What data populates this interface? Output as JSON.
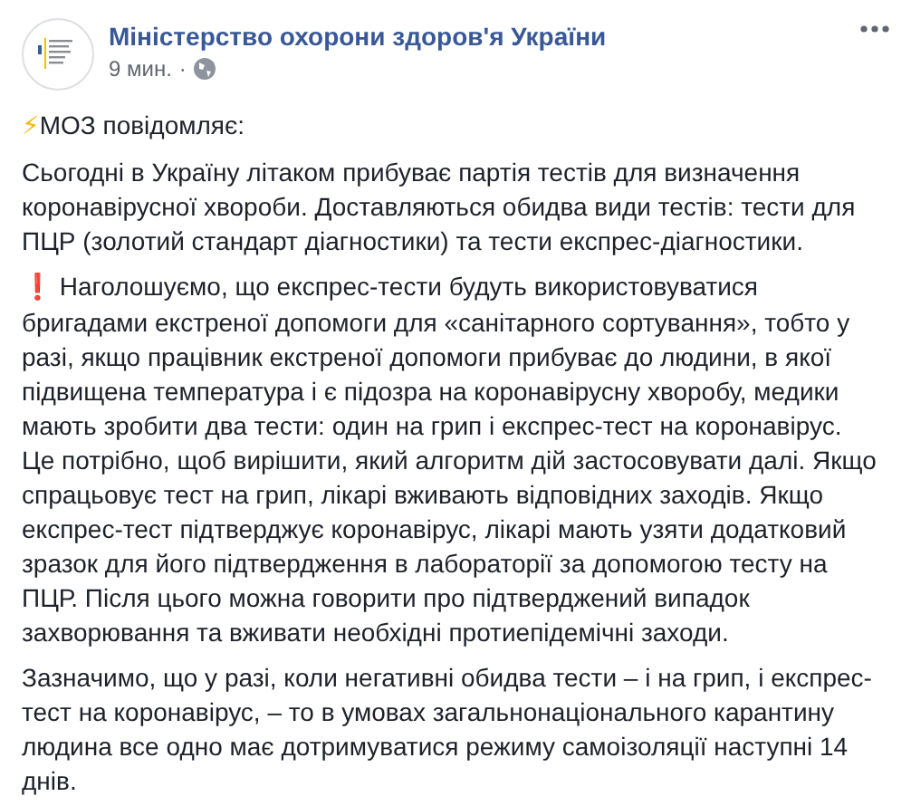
{
  "post": {
    "author": "Міністерство охорони здоров'я України",
    "time": "9 мин.",
    "separator": "·",
    "paragraphs": [
      {
        "kind": "headline",
        "marker": "⚡",
        "text": "МОЗ повідомляє:"
      },
      {
        "kind": "plain",
        "text": "Сьогодні в Україну літаком прибуває партія тестів для визначення коронавірусної хвороби. Доставляються обидва види тестів: тести для ПЦР (золотий стандарт діагностики) та тести експрес-діагностики."
      },
      {
        "kind": "warning",
        "marker": "❗",
        "text": "Наголошуємо, що експрес-тести будуть використовуватися бригадами екстреної допомоги для «санітарного сортування», тобто у разі, якщо працівник екстреної допомоги прибуває до людини, в якої підвищена температура і є підозра на коронавірусну хворобу, медики мають зробити два тести: один на грип і експрес-тест на коронавірус. Це потрібно, щоб вирішити, який алгоритм дій застосовувати далі. Якщо спрацьовує тест на грип, лікарі вживають відповідних заходів. Якщо експрес-тест підтверджує коронавірус, лікарі мають узяти додатковий зразок для його підтвердження в лабораторії за допомогою тесту на ПЦР. Після цього можна говорити про підтверджений випадок захворювання та вживати необхідні протиепідемічні заходи."
      },
      {
        "kind": "plain",
        "text": "Зазначимо, що у разі, коли негативні обидва тести – і на грип, і експрес-тест на коронавірус, – то в умовах загальнонаціонального карантину людина все одно має дотримуватися режиму самоізоляції наступні 14 днів."
      }
    ]
  }
}
